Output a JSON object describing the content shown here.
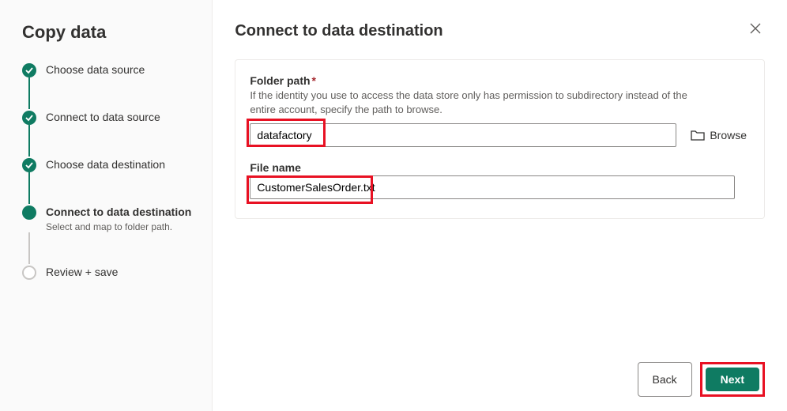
{
  "sidebar": {
    "title": "Copy data",
    "steps": [
      {
        "label": "Choose data source",
        "state": "completed"
      },
      {
        "label": "Connect to data source",
        "state": "completed"
      },
      {
        "label": "Choose data destination",
        "state": "completed"
      },
      {
        "label": "Connect to data destination",
        "state": "current",
        "desc": "Select and map to folder path."
      },
      {
        "label": "Review + save",
        "state": "pending"
      }
    ]
  },
  "main": {
    "title": "Connect to data destination",
    "folder": {
      "label": "Folder path",
      "required_marker": "*",
      "hint": "If the identity you use to access the data store only has permission to subdirectory instead of the entire account, specify the path to browse.",
      "value": "datafactory",
      "browse_label": "Browse"
    },
    "file": {
      "label": "File name",
      "value": "CustomerSalesOrder.txt"
    }
  },
  "footer": {
    "back_label": "Back",
    "next_label": "Next"
  },
  "colors": {
    "accent": "#0f7b62",
    "highlight": "#e81123"
  }
}
